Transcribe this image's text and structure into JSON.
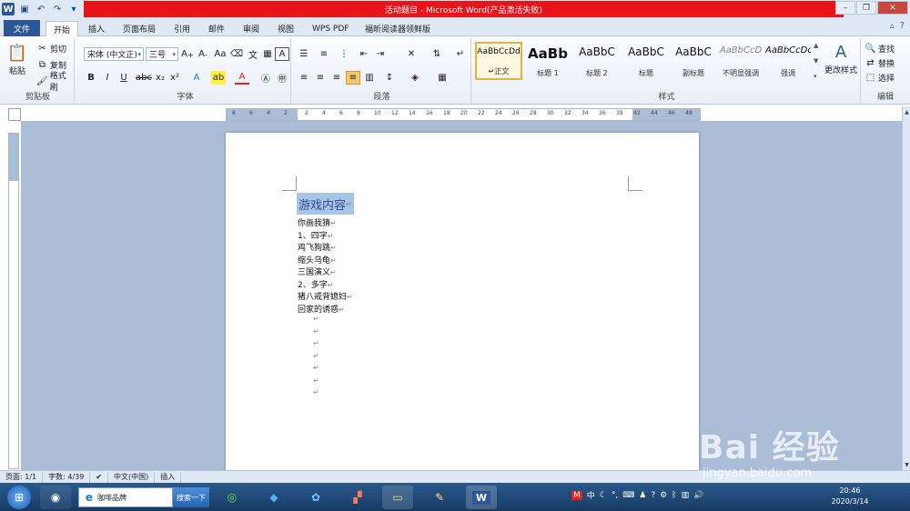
{
  "window": {
    "title": "活动题目 - Microsoft Word(产品激活失败)",
    "app_icon": "word-logo"
  },
  "ribbon_tabs": [
    "文件",
    "开始",
    "插入",
    "页面布局",
    "引用",
    "邮件",
    "审阅",
    "视图",
    "WPS PDF",
    "福昕阅读器领鲜版"
  ],
  "clipboard": {
    "paste": "粘贴",
    "cut": "剪切",
    "copy": "复制",
    "format_painter": "格式刷",
    "label": "剪贴板"
  },
  "font": {
    "name": "宋体 (中文正)",
    "size": "三号",
    "label": "字体"
  },
  "paragraph": {
    "label": "段落"
  },
  "styles": {
    "label": "样式",
    "items": [
      {
        "sample": "AaBbCcDd",
        "name": "↵正文"
      },
      {
        "sample": "AaBb",
        "name": "标题 1"
      },
      {
        "sample": "AaBbC",
        "name": "标题 2"
      },
      {
        "sample": "AaBbC",
        "name": "标题"
      },
      {
        "sample": "AaBbC",
        "name": "副标题"
      },
      {
        "sample": "AaBbCcD",
        "name": "不明显强调"
      },
      {
        "sample": "AaBbCcDd",
        "name": "强调"
      }
    ],
    "change_styles": "更改样式"
  },
  "editing": {
    "find": "查找",
    "replace": "替换",
    "select": "选择",
    "label": "编辑"
  },
  "ruler": {
    "ticks": [
      "8",
      "6",
      "4",
      "2",
      "2",
      "4",
      "6",
      "8",
      "10",
      "12",
      "14",
      "16",
      "18",
      "20",
      "22",
      "24",
      "26",
      "28",
      "30",
      "32",
      "34",
      "36",
      "38",
      "42",
      "44",
      "46",
      "48"
    ]
  },
  "document": {
    "heading": "游戏内容",
    "lines": [
      "你画我猜",
      "1、四字",
      "鸡飞狗跳",
      "缩头乌龟",
      "三国演义",
      "2、多字",
      "猪八戒背媳妇",
      "回家的诱惑"
    ],
    "empty_marks": 7,
    "paragraph_mark": "↵"
  },
  "status": {
    "page": "页面: 1/1",
    "words": "字数: 4/39",
    "language": "中文(中国)",
    "mode": "插入"
  },
  "taskbar": {
    "ie_text": "咖啡品牌",
    "search_btn": "搜索一下",
    "time": "20:46",
    "date": "2020/3/14"
  },
  "watermark": {
    "logo": "Bai 经验",
    "url": "jingyan.baidu.com"
  }
}
